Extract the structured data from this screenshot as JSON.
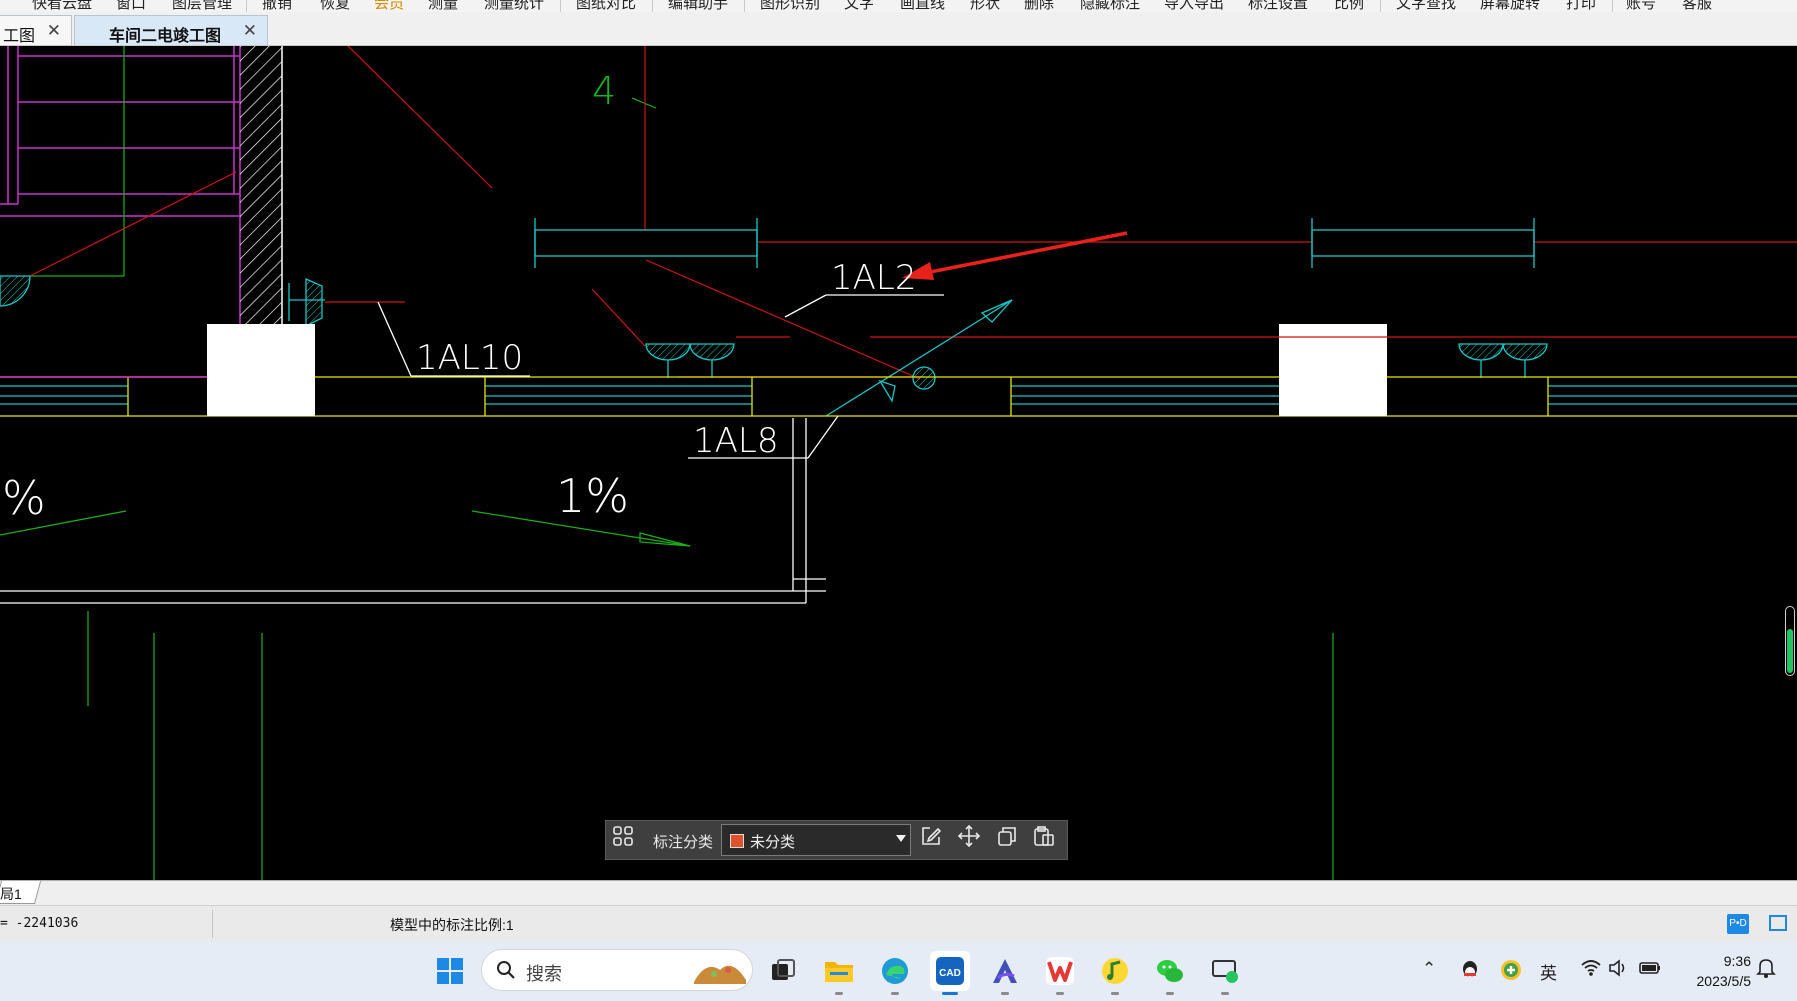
{
  "menu": {
    "items": [
      "",
      "快看云盘",
      "窗口",
      "图层管理",
      "撤销",
      "恢复",
      "会员",
      "测量",
      "测量统计",
      "图纸对比",
      "编辑助手",
      "图形识别",
      "文字",
      "画直线",
      "形状",
      "删除",
      "隐藏标注",
      "导入导出",
      "标注设置",
      "比例",
      "文字查找",
      "屏幕旋转",
      "打印",
      "账号",
      "客服"
    ]
  },
  "tabs": [
    {
      "label": "工图",
      "active": false
    },
    {
      "label": "车间二电竣工图",
      "active": true
    }
  ],
  "drawing": {
    "labels": {
      "al2": "1AL2",
      "al10": "1AL10",
      "al8": "1AL8",
      "slope_left": "%",
      "slope_right": "1%",
      "axis_mark": "4"
    }
  },
  "annotation_toolbar": {
    "label": "标注分类",
    "category_value": "未分类",
    "category_color": "#e0522a",
    "icons": [
      "grid-icon",
      "edit-icon",
      "move-icon",
      "copy-icon",
      "paste-icon"
    ]
  },
  "layout_tabs": {
    "current": "局1"
  },
  "statusbar": {
    "coordinate": "= -2241036",
    "scale": "模型中的标注比例:1"
  },
  "taskbar": {
    "search_placeholder": "搜索",
    "apps": [
      "start",
      "search",
      "taskview",
      "file-explorer",
      "edge",
      "cad-viewer",
      "app-a",
      "wps",
      "music",
      "wechat",
      "remote"
    ],
    "tray": {
      "ime": "英",
      "time": "9:36",
      "date": "2023/5/5"
    }
  },
  "colors": {
    "canvas": "#000000",
    "magenta": "#cc33cc",
    "cyan": "#19c8c8",
    "red": "#d01515",
    "yellow": "#e6e600",
    "green": "#19b319"
  }
}
